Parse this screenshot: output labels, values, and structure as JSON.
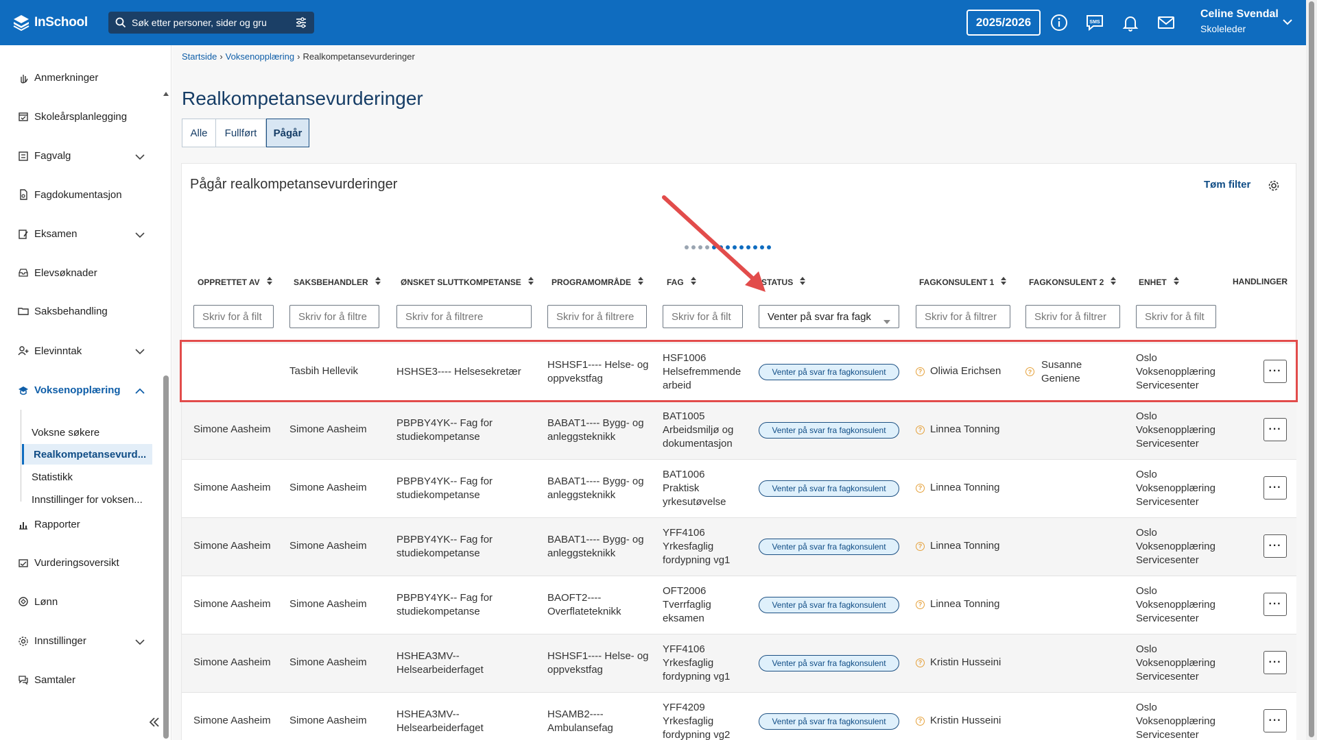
{
  "app": {
    "logo_text": "InSchool"
  },
  "search": {
    "placeholder": "Søk etter personer, sider og gru"
  },
  "header": {
    "year": "2025/2026",
    "sms_label": "SMS",
    "user_name": "Celine Svendal",
    "user_role": "Skoleleder"
  },
  "sidebar": {
    "items": [
      {
        "label": "Anmerkninger",
        "icon": "hand-icon",
        "expandable": false
      },
      {
        "label": "Skoleårsplanlegging",
        "icon": "calendar-icon",
        "expandable": false
      },
      {
        "label": "Fagvalg",
        "icon": "list-icon",
        "expandable": true
      },
      {
        "label": "Fagdokumentasjon",
        "icon": "document-icon",
        "expandable": false
      },
      {
        "label": "Eksamen",
        "icon": "exam-icon",
        "expandable": true
      },
      {
        "label": "Elevsøknader",
        "icon": "inbox-icon",
        "expandable": false
      },
      {
        "label": "Saksbehandling",
        "icon": "folder-icon",
        "expandable": false
      },
      {
        "label": "Elevinntak",
        "icon": "user-add-icon",
        "expandable": true
      },
      {
        "label": "Voksenopplæring",
        "icon": "graduation-icon",
        "expandable": true,
        "expanded": true
      },
      {
        "label": "Rapporter",
        "icon": "chart-icon",
        "expandable": false
      },
      {
        "label": "Vurderingsoversikt",
        "icon": "assessment-icon",
        "expandable": false
      },
      {
        "label": "Lønn",
        "icon": "money-icon",
        "expandable": false
      },
      {
        "label": "Innstillinger",
        "icon": "gear-icon",
        "expandable": true
      },
      {
        "label": "Samtaler",
        "icon": "chat-icon",
        "expandable": false
      }
    ],
    "subitems": [
      {
        "label": "Voksne søkere"
      },
      {
        "label": "Realkompetansevurd...",
        "active": true
      },
      {
        "label": "Statistikk"
      },
      {
        "label": "Innstillinger for voksen..."
      }
    ]
  },
  "breadcrumb": {
    "home": "Startside",
    "parent": "Voksenopplæring",
    "current": "Realkompetansevurderinger"
  },
  "page": {
    "title": "Realkompetansevurderinger"
  },
  "tabs": [
    {
      "label": "Alle"
    },
    {
      "label": "Fullført"
    },
    {
      "label": "Pågår",
      "active": true
    }
  ],
  "card": {
    "title": "Pågår realkompetansevurderinger",
    "clear_filter": "Tøm filter"
  },
  "table": {
    "headers": [
      "OPPRETTET AV",
      "SAKSBEHANDLER",
      "ØNSKET SLUTTKOMPETANSE",
      "PROGRAMOMRÅDE",
      "FAG",
      "STATUS",
      "FAGKONSULENT 1",
      "FAGKONSULENT 2",
      "ENHET",
      "HANDLINGER"
    ],
    "filters": {
      "opprettet_av": "Skriv for å filt",
      "saksbehandler": "Skriv for å filtre",
      "kompetanse": "Skriv for å filtrere",
      "programomrade": "Skriv for å filtrere",
      "fag": "Skriv for å filt",
      "status": "Venter på svar fra fagk",
      "fagkonsulent1": "Skriv for å filtrer",
      "fagkonsulent2": "Skriv for å filtrer",
      "enhet": "Skriv for å filt"
    },
    "rows": [
      {
        "opprettet_av": "",
        "saksbehandler": "Tasbih Hellevik",
        "kompetanse": [
          "HSHSE3---- Helsesekretær"
        ],
        "programomrade": [
          "HSHSF1---- Helse- og",
          "oppvekstfag"
        ],
        "fag": [
          "HSF1006",
          "Helsefremmende",
          "arbeid"
        ],
        "status": "Venter på svar fra fagkonsulent",
        "fagkonsulent1": "Oliwia Erichsen",
        "fagkonsulent2": [
          "Susanne",
          "Geniene"
        ],
        "enhet": [
          "Oslo",
          "Voksenopplæring",
          "Servicesenter"
        ]
      },
      {
        "opprettet_av": "Simone Aasheim",
        "saksbehandler": "Simone Aasheim",
        "kompetanse": [
          "PBPBY4YK-- Fag for",
          "studiekompetanse"
        ],
        "programomrade": [
          "BABAT1---- Bygg- og",
          "anleggsteknikk"
        ],
        "fag": [
          "BAT1005",
          "Arbeidsmiljø og",
          "dokumentasjon"
        ],
        "status": "Venter på svar fra fagkonsulent",
        "fagkonsulent1": "Linnea Tonning",
        "fagkonsulent2": [],
        "enhet": [
          "Oslo",
          "Voksenopplæring",
          "Servicesenter"
        ]
      },
      {
        "opprettet_av": "Simone Aasheim",
        "saksbehandler": "Simone Aasheim",
        "kompetanse": [
          "PBPBY4YK-- Fag for",
          "studiekompetanse"
        ],
        "programomrade": [
          "BABAT1---- Bygg- og",
          "anleggsteknikk"
        ],
        "fag": [
          "BAT1006",
          "Praktisk",
          "yrkesutøvelse"
        ],
        "status": "Venter på svar fra fagkonsulent",
        "fagkonsulent1": "Linnea Tonning",
        "fagkonsulent2": [],
        "enhet": [
          "Oslo",
          "Voksenopplæring",
          "Servicesenter"
        ]
      },
      {
        "opprettet_av": "Simone Aasheim",
        "saksbehandler": "Simone Aasheim",
        "kompetanse": [
          "PBPBY4YK-- Fag for",
          "studiekompetanse"
        ],
        "programomrade": [
          "BABAT1---- Bygg- og",
          "anleggsteknikk"
        ],
        "fag": [
          "YFF4106",
          "Yrkesfaglig",
          "fordypning vg1"
        ],
        "status": "Venter på svar fra fagkonsulent",
        "fagkonsulent1": "Linnea Tonning",
        "fagkonsulent2": [],
        "enhet": [
          "Oslo",
          "Voksenopplæring",
          "Servicesenter"
        ]
      },
      {
        "opprettet_av": "Simone Aasheim",
        "saksbehandler": "Simone Aasheim",
        "kompetanse": [
          "PBPBY4YK-- Fag for",
          "studiekompetanse"
        ],
        "programomrade": [
          "BAOFT2----",
          "Overflateteknikk"
        ],
        "fag": [
          "OFT2006",
          "Tverrfaglig",
          "eksamen"
        ],
        "status": "Venter på svar fra fagkonsulent",
        "fagkonsulent1": "Linnea Tonning",
        "fagkonsulent2": [],
        "enhet": [
          "Oslo",
          "Voksenopplæring",
          "Servicesenter"
        ]
      },
      {
        "opprettet_av": "Simone Aasheim",
        "saksbehandler": "Simone Aasheim",
        "kompetanse": [
          "HSHEA3MV--",
          "Helsearbeiderfaget"
        ],
        "programomrade": [
          "HSHSF1---- Helse- og",
          "oppvekstfag"
        ],
        "fag": [
          "YFF4106",
          "Yrkesfaglig",
          "fordypning vg1"
        ],
        "status": "Venter på svar fra fagkonsulent",
        "fagkonsulent1": "Kristin Husseini",
        "fagkonsulent2": [],
        "enhet": [
          "Oslo",
          "Voksenopplæring",
          "Servicesenter"
        ]
      },
      {
        "opprettet_av": "Simone Aasheim",
        "saksbehandler": "Simone Aasheim",
        "kompetanse": [
          "HSHEA3MV--",
          "Helsearbeiderfaget"
        ],
        "programomrade": [
          "HSAMB2----",
          "Ambulansefag"
        ],
        "fag": [
          "YFF4209",
          "Yrkesfaglig",
          "fordypning vg2"
        ],
        "status": "Venter på svar fra fagkonsulent",
        "fagkonsulent1": "Kristin Husseini",
        "fagkonsulent2": [],
        "enhet": [
          "Oslo",
          "Voksenopplæring",
          "Servicesenter"
        ]
      }
    ],
    "more_label": "···"
  },
  "colors": {
    "brand": "#0f6cbf",
    "highlight": "#e24c4b",
    "arrow": "#e24c4b",
    "badge_bg": "#dff0fb",
    "warning": "#e5a13b"
  }
}
